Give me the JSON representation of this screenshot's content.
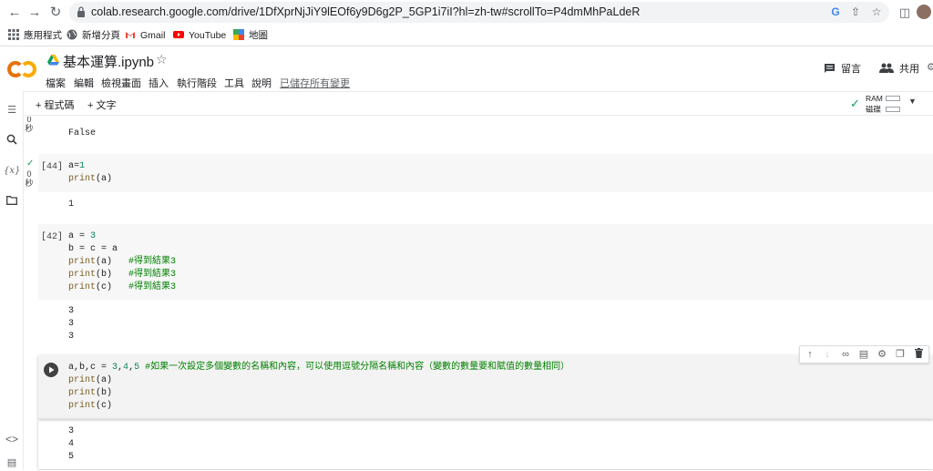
{
  "browser": {
    "url": "colab.research.google.com/drive/1DfXprNjJiY9lEOf6y9D6g2P_5GP1i7iI?hl=zh-tw#scrollTo=P4dmMhPaLdeR",
    "back_icon": "arrow-left-icon",
    "forward_icon": "arrow-right-icon",
    "reload_icon": "reload-icon"
  },
  "bookmarks": {
    "apps": "應用程式",
    "new_tab": "新增分頁",
    "gmail": "Gmail",
    "youtube": "YouTube",
    "maps": "地圖"
  },
  "header": {
    "logo_text": "CO",
    "title": "基本運算.ipynb",
    "menus": [
      "檔案",
      "編輯",
      "檢視畫面",
      "插入",
      "執行階段",
      "工具",
      "說明"
    ],
    "saved_status": "已儲存所有變更",
    "comment_label": "留言",
    "share_label": "共用"
  },
  "toolbar": {
    "add_code": "+ 程式碼",
    "add_text": "+ 文字",
    "ram_label": "RAM",
    "disk_label": "磁碟"
  },
  "cells": {
    "c0": {
      "time": "0\n秒",
      "output": "False"
    },
    "c1": {
      "count": "[44]",
      "time": "0\n秒",
      "output": "1"
    },
    "c2": {
      "count": "[42]",
      "output": [
        "3",
        "3",
        "3"
      ]
    },
    "c3": {
      "output": [
        "3",
        "4",
        "5"
      ]
    }
  },
  "colors": {
    "accent_orange": "#F9AB00",
    "accent_orange_dark": "#E8710A",
    "number_green": "#098658",
    "comment_green": "#008000",
    "check_green": "#0F9D58"
  }
}
